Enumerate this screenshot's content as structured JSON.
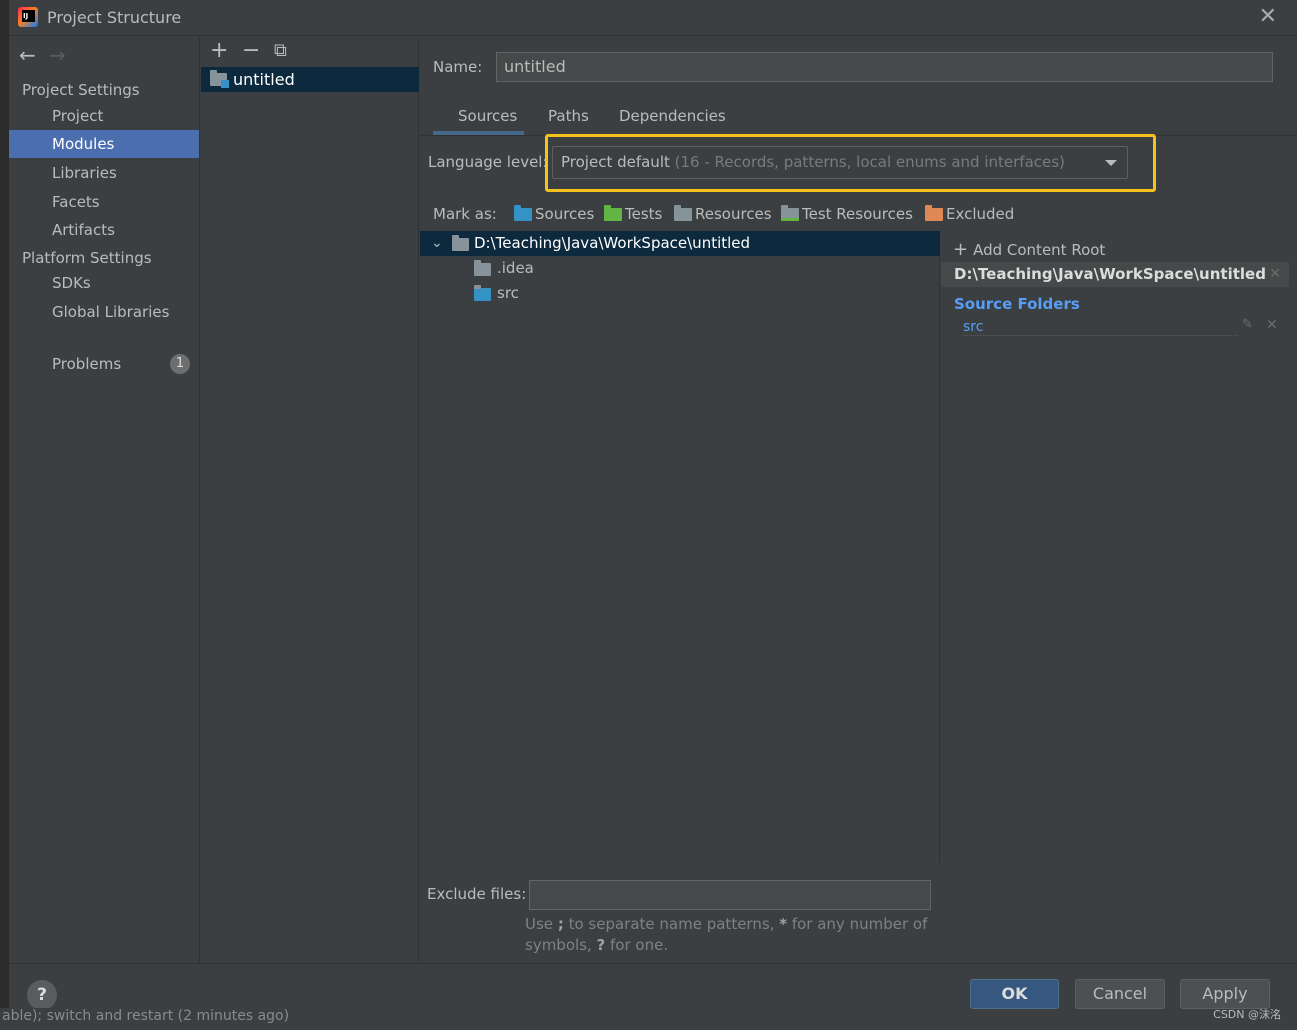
{
  "window": {
    "title": "Project Structure"
  },
  "nav": {
    "project_settings_header": "Project Settings",
    "project_settings_items": [
      "Project",
      "Modules",
      "Libraries",
      "Facets",
      "Artifacts"
    ],
    "platform_settings_header": "Platform Settings",
    "platform_settings_items": [
      "SDKs",
      "Global Libraries"
    ],
    "problems_label": "Problems",
    "problems_count": "1",
    "selected": "Modules"
  },
  "modules": {
    "toolbar": {
      "add": "+",
      "remove": "−",
      "copy": "⧉"
    },
    "items": [
      "untitled"
    ]
  },
  "module_detail": {
    "name_label": "Name:",
    "name_value": "untitled",
    "tabs": [
      "Sources",
      "Paths",
      "Dependencies"
    ],
    "active_tab": "Sources",
    "language_level_label": "Language level:",
    "language_level_value": "Project default",
    "language_level_detail": "(16 - Records, patterns, local enums and interfaces)",
    "mark_as_label": "Mark as:",
    "mark_as": [
      {
        "label": "Sources",
        "color": "#3592c4"
      },
      {
        "label": "Tests",
        "color": "#62b543"
      },
      {
        "label": "Resources",
        "color": "#87939a"
      },
      {
        "label": "Test Resources",
        "color": "#87939a"
      },
      {
        "label": "Excluded",
        "color": "#e08855"
      }
    ],
    "tree": [
      {
        "label": "D:\\Teaching\\Java\\WorkSpace\\untitled",
        "expanded": true,
        "selected": true
      },
      {
        "label": ".idea"
      },
      {
        "label": "src",
        "source_root": true
      }
    ],
    "exclude_files_label": "Exclude files:",
    "exclude_files_value": "",
    "exclude_hint_1": "Use",
    "exclude_hint_semicolon": ";",
    "exclude_hint_2": "to separate name patterns,",
    "exclude_hint_star": "*",
    "exclude_hint_3": "for any number of symbols,",
    "exclude_hint_q": "?",
    "exclude_hint_4": "for one."
  },
  "content_roots": {
    "add_label": "Add Content Root",
    "root_path": "D:\\Teaching\\Java\\WorkSpace\\untitled",
    "source_folders_header": "Source Folders",
    "source_folders": [
      "src"
    ]
  },
  "footer": {
    "help": "?",
    "ok": "OK",
    "cancel": "Cancel",
    "apply": "Apply",
    "watermark": "CSDN @沫洺"
  },
  "background": {
    "partial_text": "able); switch and restart (2 minutes ago)"
  },
  "colors": {
    "accent_selection": "#4b6eaf",
    "tree_selection": "#0d293e",
    "highlight_box": "#f5c21b",
    "source_blue": "#589df6"
  }
}
